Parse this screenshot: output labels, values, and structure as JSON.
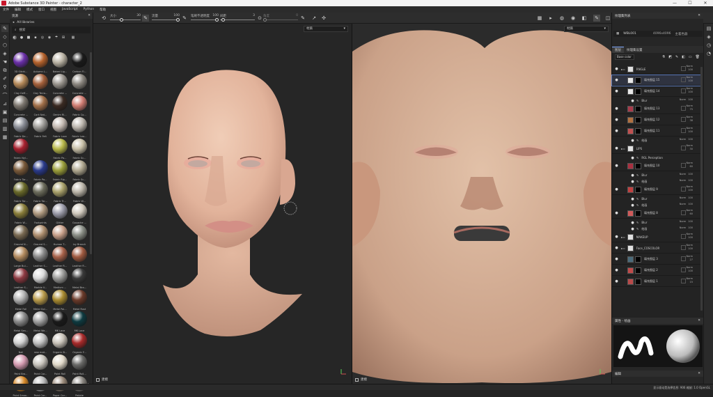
{
  "window": {
    "title": "Adobe Substance 3D Painter - character_2",
    "controls": [
      "—",
      "☐",
      "✕"
    ]
  },
  "menu": [
    "文件",
    "编辑",
    "模式",
    "窗口",
    "视图",
    "JavaScript",
    "Python",
    "帮助"
  ],
  "toolbar": {
    "size_label": "大小",
    "size_value": "30",
    "flow_label": "流量",
    "flow_value": "100",
    "stroke_opacity_label": "笔刷不透明度",
    "stroke_opacity_value": "100",
    "spacing_label": "间距",
    "spacing_value": "3",
    "angle_label": "角度",
    "angle_value": "0"
  },
  "shelf": {
    "title": "资源",
    "path": "All libraries",
    "search_placeholder": "搜索",
    "materials": [
      {
        "name": "3D Sitchi...",
        "color": "#6a2fa8"
      },
      {
        "name": "Autumn L...",
        "color": "#b5622c"
      },
      {
        "name": "Baked Lig...",
        "color": "#b9b2a3"
      },
      {
        "name": "Carbon Fi...",
        "color": "#1a1a1a"
      },
      {
        "name": "Clay Geff...",
        "color": "#b68a5a"
      },
      {
        "name": "Clay Terra...",
        "color": "#a6613b"
      },
      {
        "name": "Concrete ...",
        "color": "#9a958e"
      },
      {
        "name": "Concrete ...",
        "color": "#8c8780"
      },
      {
        "name": "Concrete ...",
        "color": "#7e7870"
      },
      {
        "name": "Cork Nat...",
        "color": "#a3714a"
      },
      {
        "name": "Denim Ri...",
        "color": "#3a2a22"
      },
      {
        "name": "Fabric Co...",
        "color": "#d07c72"
      },
      {
        "name": "Fabric De...",
        "color": "#8a8d96"
      },
      {
        "name": "Fabric Felt",
        "color": "#a09e9a"
      },
      {
        "name": "Fabric Lace",
        "color": "#c3b8b0"
      },
      {
        "name": "Fabric Lea...",
        "color": "#bcb6ae"
      },
      {
        "name": "Fabric Nyl...",
        "color": "#a8212f"
      },
      {
        "name": "",
        "color": ""
      },
      {
        "name": "Fabric Pa...",
        "color": "#b8b84a"
      },
      {
        "name": "Fabric Sc...",
        "color": "#c8c0a8"
      },
      {
        "name": "Fabric Tar...",
        "color": "#7a5a3a"
      },
      {
        "name": "Fabric Pa...",
        "color": "#2a3a8a"
      },
      {
        "name": "Fabric Rip...",
        "color": "#9a9d3a"
      },
      {
        "name": "Fabric Sc...",
        "color": "#b0a890"
      },
      {
        "name": "Fabric Tar...",
        "color": "#6a6a2a"
      },
      {
        "name": "Fabric Tar...",
        "color": "#6c6c5c"
      },
      {
        "name": "Fabric Tr...",
        "color": "#a8a06a"
      },
      {
        "name": "Fabric W...",
        "color": "#bab4a8"
      },
      {
        "name": "Fabric W...",
        "color": "#8a7e3a"
      },
      {
        "name": "Footprints",
        "color": "#b09a80"
      },
      {
        "name": "Glitter",
        "color": "#9a9aa8"
      },
      {
        "name": "Gouache ...",
        "color": "#cfc8bc"
      },
      {
        "name": "Ground N...",
        "color": "#7a6a52"
      },
      {
        "name": "Ground S...",
        "color": "#b09070"
      },
      {
        "name": "Human T...",
        "color": "#c9a08a"
      },
      {
        "name": "Ivy Branch",
        "color": "#8a8e86"
      },
      {
        "name": "Large Bui...",
        "color": "#b48c60"
      },
      {
        "name": "Leather S...",
        "color": "#8a8a8a"
      },
      {
        "name": "Leather R...",
        "color": "#a8624a"
      },
      {
        "name": "Leather R...",
        "color": "#a05a40"
      },
      {
        "name": "Leather S...",
        "color": "#8e3a42"
      },
      {
        "name": "Marble V...",
        "color": "#dadada"
      },
      {
        "name": "Medium ...",
        "color": "#9a9a98"
      },
      {
        "name": "Metal Bra...",
        "color": "#3a3a3a"
      },
      {
        "name": "Metal Foil",
        "color": "#b0b0b0"
      },
      {
        "name": "Metal Gol...",
        "color": "#b89a4a"
      },
      {
        "name": "Metal Pol...",
        "color": "#a88a30"
      },
      {
        "name": "Metal Rust",
        "color": "#6a3a2a"
      },
      {
        "name": "Metal Sen...",
        "color": "#8a8a8a"
      },
      {
        "name": "Metal We...",
        "color": "#a0a0a0"
      },
      {
        "name": "MK Lace",
        "color": "#1a1a1a"
      },
      {
        "name": "MK Lace",
        "color": "#0e3a40"
      },
      {
        "name": "Nail",
        "color": "#d0d0d0"
      },
      {
        "name": "new mat...",
        "color": "#c0c0c0"
      },
      {
        "name": "Organic B...",
        "color": "#c8c2b8"
      },
      {
        "name": "Organic F...",
        "color": "#a82a2a"
      },
      {
        "name": "Paint Bra...",
        "color": "#d49ab0"
      },
      {
        "name": "Paint Car...",
        "color": "#c8c4bc"
      },
      {
        "name": "Paint Roll",
        "color": "#e0d8c8"
      },
      {
        "name": "Paint Roll...",
        "color": "#6a6a68"
      },
      {
        "name": "Paint Smoo...",
        "color": "#d88a2a"
      },
      {
        "name": "Paint Cor...",
        "color": "#b8b8b8"
      },
      {
        "name": "Paper Cor...",
        "color": "#9a8a7a"
      },
      {
        "name": "Pebble",
        "color": "#8a8680"
      }
    ]
  },
  "viewport3d": {
    "mode": "材质",
    "label": "建模"
  },
  "viewport2d": {
    "mode": "材质",
    "label": "建模"
  },
  "texture_set": {
    "title": "纹理集列表",
    "name": "WBL001",
    "resolution": "4096x4096",
    "shader": "主着色器"
  },
  "layers": {
    "tabs": [
      "图层",
      "纹理集设置"
    ],
    "blend_dropdown": "Base color",
    "items": [
      {
        "name": "RNGLE",
        "type": "folder",
        "blend": "Norm",
        "opacity": "100",
        "thumb": "#e0e0e0",
        "indent": 0
      },
      {
        "name": "填充图层 15",
        "type": "fill",
        "blend": "Norm",
        "opacity": "100",
        "thumb": "#e8e8e8",
        "indent": 1,
        "selected": true
      },
      {
        "name": "填充图层 14",
        "type": "fill",
        "blend": "Norm",
        "opacity": "100",
        "thumb": "#e8e8e8",
        "indent": 1
      },
      {
        "name": "Blur",
        "type": "sub",
        "blend": "Norm",
        "opacity": "100",
        "indent": 2
      },
      {
        "name": "填充图层 13",
        "type": "fill",
        "blend": "Norm",
        "opacity": "75",
        "thumb": "#a83a4a",
        "indent": 1
      },
      {
        "name": "填充图层 12",
        "type": "fill",
        "blend": "Norm",
        "opacity": "38",
        "thumb": "#b07040",
        "indent": 1
      },
      {
        "name": "填充图层 11",
        "type": "fill",
        "blend": "Norm",
        "opacity": "100",
        "thumb": "#c05050",
        "indent": 1
      },
      {
        "name": "绘画",
        "type": "sub",
        "blend": "Norm",
        "opacity": "100",
        "indent": 2
      },
      {
        "name": "LIPS",
        "type": "folder",
        "blend": "Norm",
        "opacity": "30",
        "thumb": "#e0e0e0",
        "indent": 0
      },
      {
        "name": "RGL Perception",
        "type": "sub",
        "blend": "",
        "opacity": "",
        "indent": 2
      },
      {
        "name": "填充图层 10",
        "type": "fill",
        "blend": "Norm",
        "opacity": "60",
        "thumb": "#a83040",
        "indent": 1
      },
      {
        "name": "Blur",
        "type": "sub",
        "blend": "Norm",
        "opacity": "100",
        "indent": 2
      },
      {
        "name": "绘画",
        "type": "sub",
        "blend": "Norm",
        "opacity": "100",
        "indent": 2
      },
      {
        "name": "填充图层 9",
        "type": "fill",
        "blend": "Norm",
        "opacity": "100",
        "thumb": "#c04040",
        "indent": 1
      },
      {
        "name": "Blur",
        "type": "sub",
        "blend": "Norm",
        "opacity": "100",
        "indent": 2
      },
      {
        "name": "绘画",
        "type": "sub",
        "blend": "Norm",
        "opacity": "100",
        "indent": 2
      },
      {
        "name": "填充图层 8",
        "type": "fill",
        "blend": "Norm",
        "opacity": "60",
        "thumb": "#d05a5a",
        "indent": 1
      },
      {
        "name": "Blur",
        "type": "sub",
        "blend": "Norm",
        "opacity": "100",
        "indent": 2
      },
      {
        "name": "绘画",
        "type": "sub",
        "blend": "Norm",
        "opacity": "100",
        "indent": 2
      },
      {
        "name": "MAKEUP",
        "type": "folder",
        "blend": "Norm",
        "opacity": "100",
        "thumb": "#e0e0e0",
        "indent": 0
      },
      {
        "name": "Face_COSCOLOR",
        "type": "folder",
        "blend": "Norm",
        "opacity": "100",
        "thumb": "#e0e0e0",
        "indent": 0
      },
      {
        "name": "填充图层 3",
        "type": "fill",
        "blend": "Norm",
        "opacity": "27",
        "thumb": "#4a6a7a",
        "indent": 1
      },
      {
        "name": "填充图层 2",
        "type": "fill",
        "blend": "Norm",
        "opacity": "100",
        "thumb": "#c04a4a",
        "indent": 1
      },
      {
        "name": "填充图层 1",
        "type": "fill",
        "blend": "Norm",
        "opacity": "15",
        "thumb": "#b84a4a",
        "indent": 1
      }
    ]
  },
  "properties": {
    "title": "属性 - 绘画"
  },
  "bottom_panel": {
    "title": "编辑"
  },
  "status": {
    "left": "",
    "right": "显示驱动是选择信息: 906  缩放: 1.0  OpenGL"
  }
}
